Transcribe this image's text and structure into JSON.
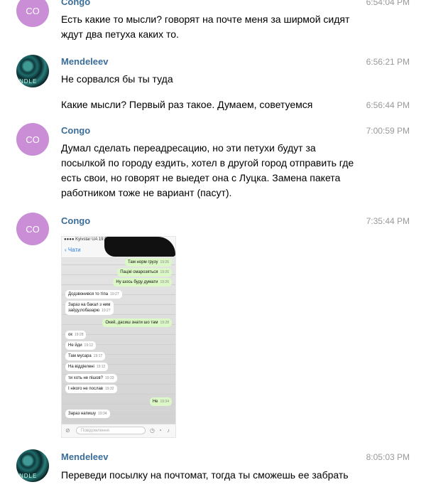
{
  "messages": [
    {
      "sender": "Congo",
      "time": "6:54:04 PM",
      "text": "Есть какие то мысли? говорят на почте меня за ширмой сидят ждут два петуха каких то."
    },
    {
      "sender": "Mendeleev",
      "time": "6:56:21 PM",
      "text": "Не сорвался бы ты туда"
    },
    {
      "time": "6:56:44 PM",
      "text": "Какие мысли? Первый раз такое. Думаем, советуемся"
    },
    {
      "sender": "Congo",
      "time": "7:00:59 PM",
      "text": "Думал сделать переадресацию, но эти петухи будут за посылкой по городу ездить, хотел в другой город отправить где есть свои, но говорят не выедет она с Луцка. Замена пакета работником тоже не вариант (пасут)."
    },
    {
      "sender": "Congo",
      "time": "7:35:44 PM"
    },
    {
      "sender": "Mendeleev",
      "time": "8:05:03 PM",
      "text": "Переведи посылку на почтомат, тогда ты сможешь ее забрать"
    }
  ],
  "avatar_initials": {
    "congo": "CO",
    "mendeleev": "NDLE"
  },
  "phone": {
    "status": "●●●● Kyivstar UA  19:34",
    "back_label": "Чати",
    "input_placeholder": "Повідомлення",
    "bubbles": [
      {
        "text": "Там норм грузу",
        "time": "19:26"
      },
      {
        "text": "Пацікі смарозяться",
        "time": "19:26"
      },
      {
        "text": "Ну шось буду думати",
        "time": "19:26"
      },
      {
        "text": "Додзвонився то тіпа",
        "time": "19:27"
      },
      {
        "text": "Зараз на бакал з ним",
        "time": ""
      },
      {
        "text": "зайду,побазарю",
        "time": "19:27"
      },
      {
        "text": "Окей, дасиш знати шо там",
        "time": "19:28"
      },
      {
        "text": "ок",
        "time": "19:28"
      },
      {
        "text": "Не йди",
        "time": "19:12"
      },
      {
        "text": "Там мусара",
        "time": "19:17"
      },
      {
        "text": "На віддіелені",
        "time": "19:12"
      },
      {
        "text": "ти хоть не пішов?",
        "time": "19:33"
      },
      {
        "text": "І нікого не послав",
        "time": "19:32"
      },
      {
        "text": "Не",
        "time": "19:34"
      },
      {
        "text": "Зараз напишу",
        "time": "19:34"
      }
    ]
  },
  "colors": {
    "sender_name": "#3a6d99",
    "congo_avatar": "#c98ed6",
    "timestamp": "#999999",
    "outgoing_bubble": "#dcf8c6"
  }
}
